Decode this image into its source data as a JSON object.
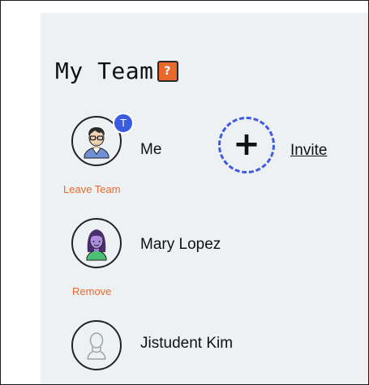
{
  "team": {
    "title": "My Team",
    "help_badge": "?",
    "members": [
      {
        "name": "Me",
        "role_badge": "T",
        "action": "Leave Team",
        "avatar": "male-avatar-with-glasses"
      },
      {
        "name": "Mary Lopez",
        "action": "Remove",
        "avatar": "female-avatar"
      },
      {
        "name": "Jistudent Kim",
        "avatar": "placeholder-person-avatar"
      }
    ],
    "invite": {
      "label": "Invite",
      "icon": "plus-icon"
    }
  },
  "colors": {
    "panel_bg": "#eef1f3",
    "accent_orange": "#e8692c",
    "accent_blue": "#3b5be0"
  }
}
